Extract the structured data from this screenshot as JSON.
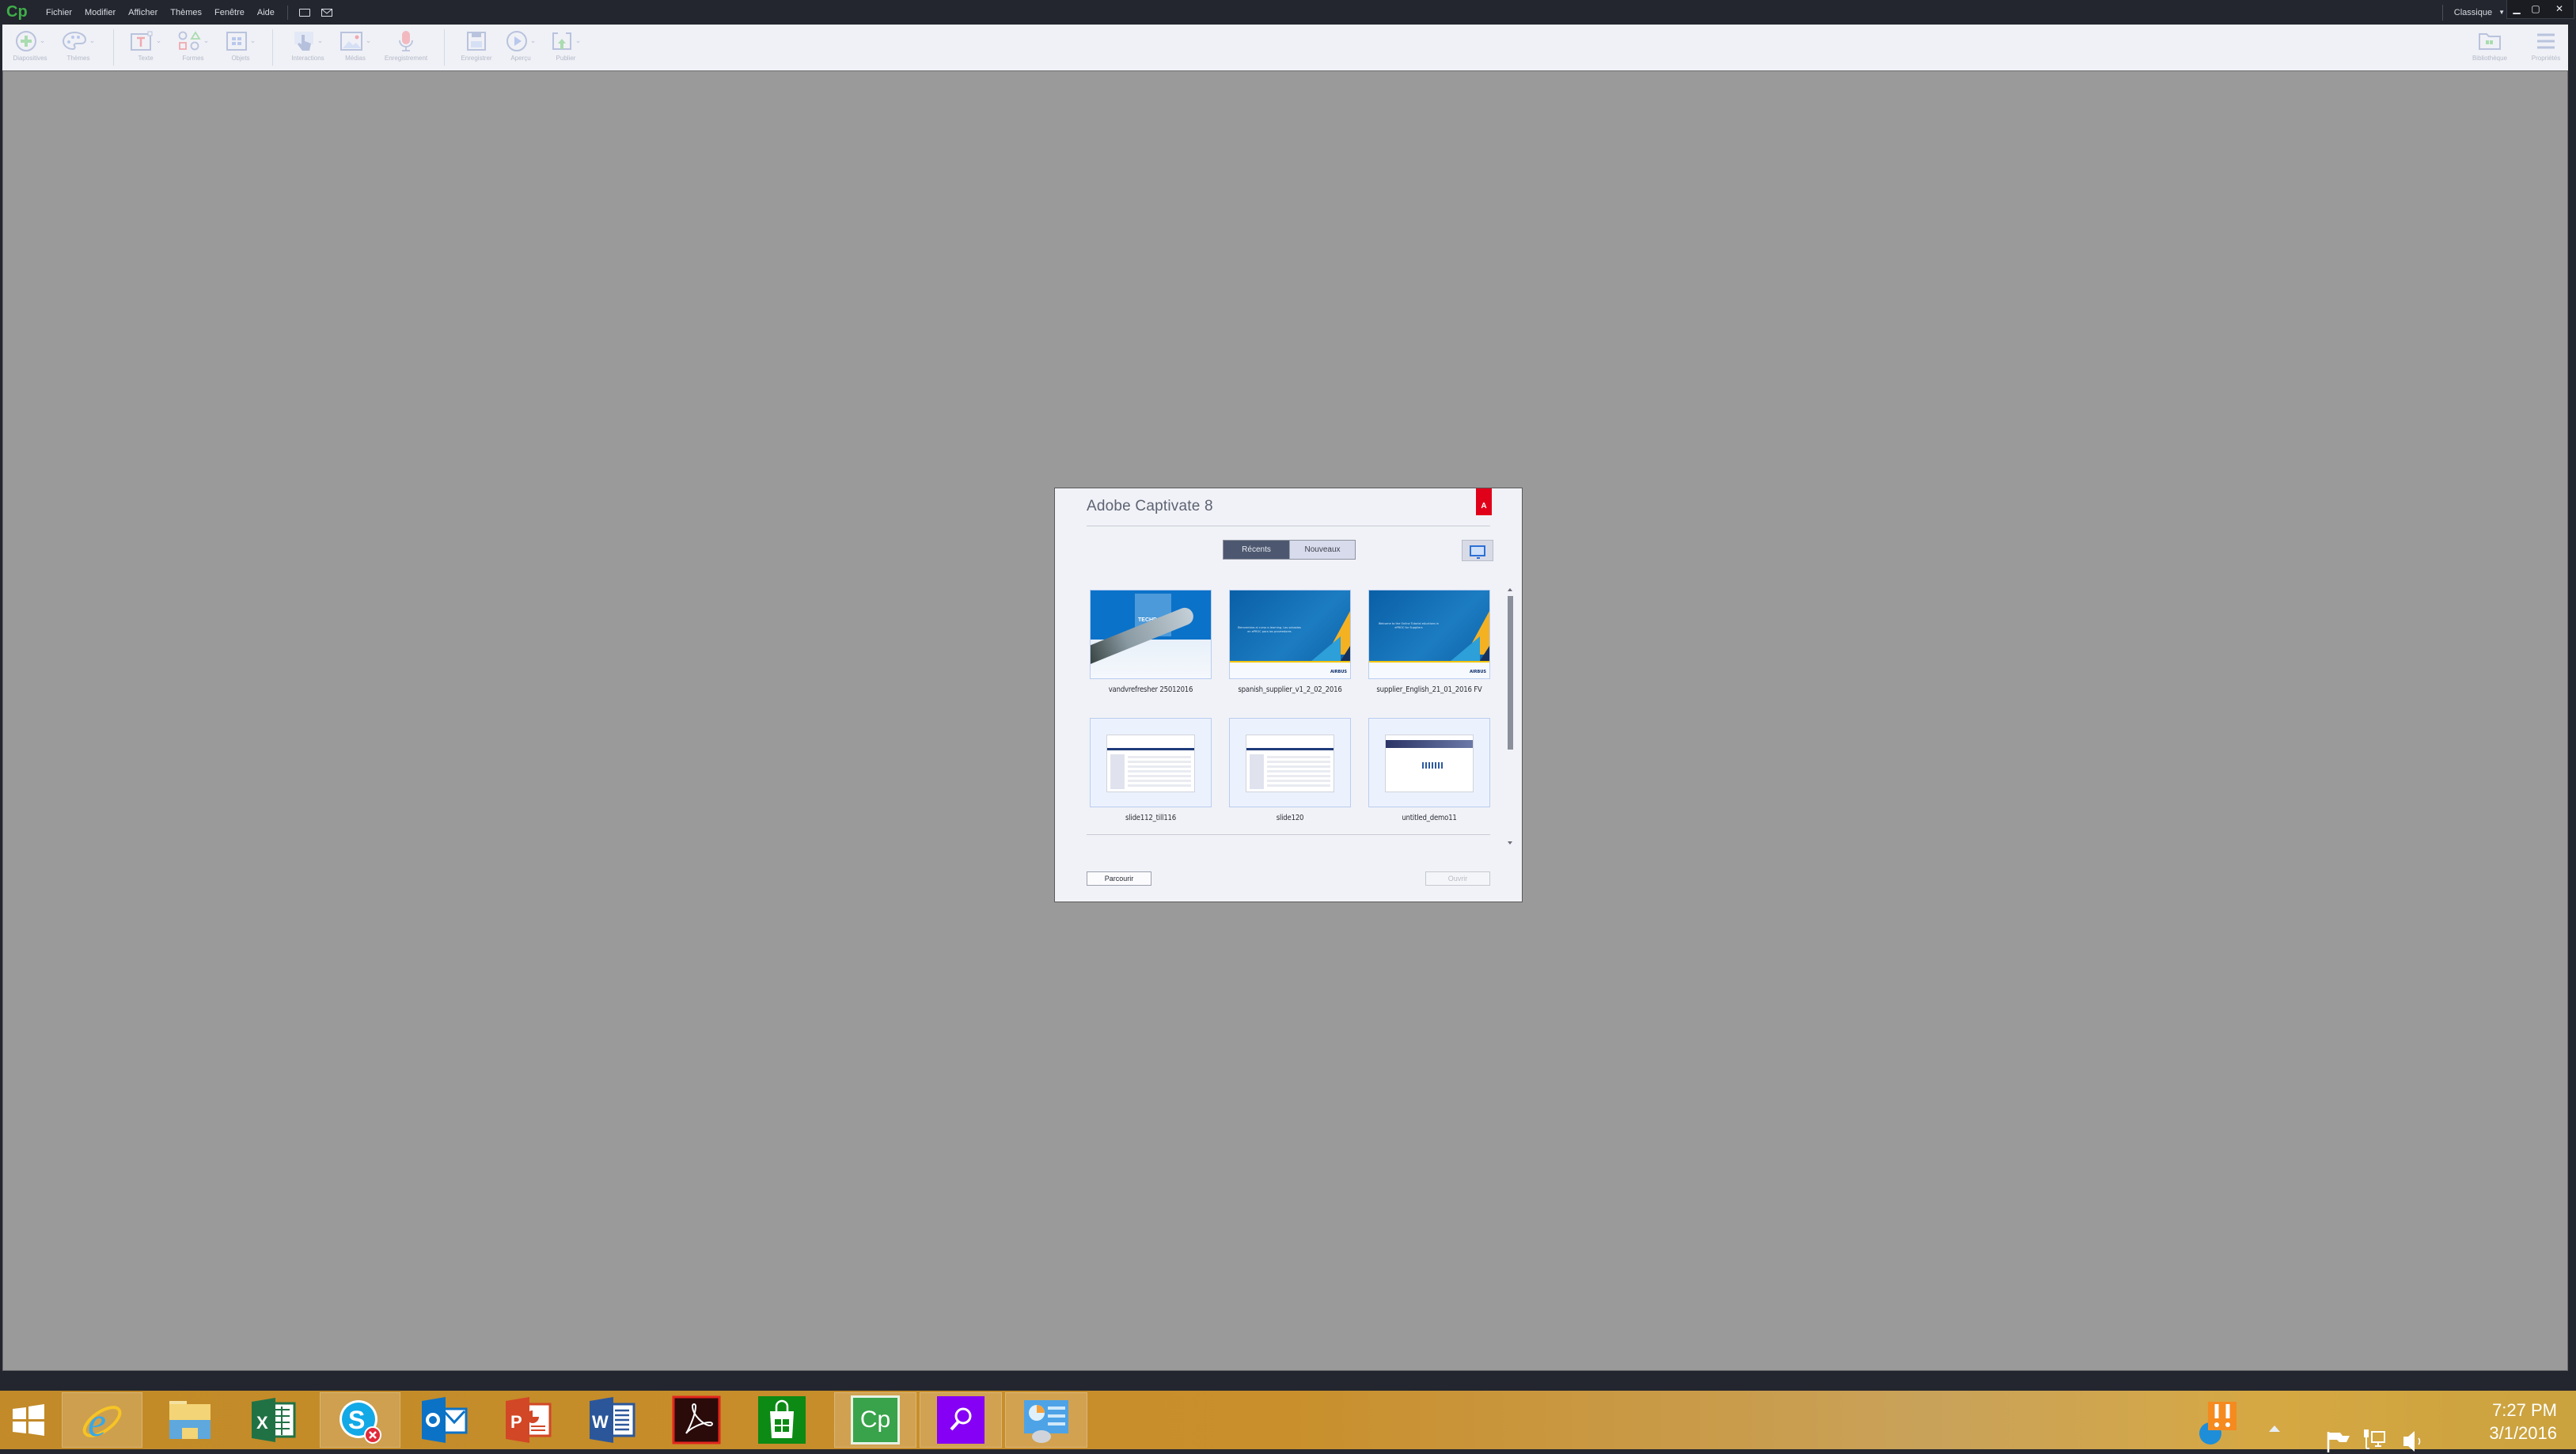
{
  "app": {
    "logo": "Cp",
    "menu": [
      "Fichier",
      "Modifier",
      "Afficher",
      "Thèmes",
      "Fenêtre",
      "Aide"
    ],
    "workspace": "Classique",
    "window_controls": {
      "minimize": "▁",
      "maximize": "▢",
      "close": "✕"
    }
  },
  "toolbar": {
    "groups": [
      [
        {
          "label": "Diapositives",
          "icon": "plus-circle-icon",
          "dropdown": true
        },
        {
          "label": "Thèmes",
          "icon": "palette-icon",
          "dropdown": true
        }
      ],
      [
        {
          "label": "Texte",
          "icon": "text-box-icon",
          "dropdown": true
        },
        {
          "label": "Formes",
          "icon": "shapes-icon",
          "dropdown": true
        },
        {
          "label": "Objets",
          "icon": "objects-grid-icon",
          "dropdown": true
        }
      ],
      [
        {
          "label": "Interactions",
          "icon": "hand-pointer-icon",
          "dropdown": true
        },
        {
          "label": "Médias",
          "icon": "image-icon",
          "dropdown": true
        },
        {
          "label": "Enregistrement",
          "icon": "microphone-icon",
          "dropdown": false
        }
      ],
      [
        {
          "label": "Enregistrer",
          "icon": "floppy-disk-icon",
          "dropdown": false
        },
        {
          "label": "Aperçu",
          "icon": "play-circle-icon",
          "dropdown": true
        },
        {
          "label": "Publier",
          "icon": "publish-icon",
          "dropdown": true
        }
      ]
    ],
    "right": [
      {
        "label": "Bibliothèque",
        "icon": "library-folder-icon"
      },
      {
        "label": "Propriétés",
        "icon": "properties-lines-icon"
      }
    ]
  },
  "dialog": {
    "title": "Adobe Captivate 8",
    "adobe_logo": "A",
    "tabs": [
      {
        "label": "Récents",
        "active": true
      },
      {
        "label": "Nouveaux",
        "active": false
      }
    ],
    "view_toggle_icon": "monitor-view-icon",
    "projects": [
      {
        "name": "vandvrefresher 25012016",
        "thumb": "techdata",
        "thumb_text": "TECHDATA"
      },
      {
        "name": "spanish_supplier_v1_2_02_2016",
        "thumb": "blue",
        "thumb_text": "Bienvenidos al curso e-learning. Las subastas en ePROC para los proveedores",
        "brand": "AIRBUS"
      },
      {
        "name": "supplier_English_21_01_2016 FV",
        "thumb": "blue",
        "thumb_text": "Welcome to the Online Tutorial eAuctions in ePROC for Suppliers",
        "brand": "AIRBUS"
      },
      {
        "name": "slide112_till116",
        "thumb": "screenshot"
      },
      {
        "name": "slide120",
        "thumb": "screenshot"
      },
      {
        "name": "untitled_demo11",
        "thumb": "screenshot2"
      }
    ],
    "browse_label": "Parcourir",
    "open_label": "Ouvrir",
    "open_enabled": false
  },
  "taskbar": {
    "apps": [
      {
        "name": "start",
        "icon": "windows-start-icon"
      },
      {
        "name": "Internet Explorer",
        "icon": "internet-explorer-icon",
        "active": true
      },
      {
        "name": "File Explorer",
        "icon": "file-explorer-icon"
      },
      {
        "name": "Excel",
        "icon": "excel-icon"
      },
      {
        "name": "Skype",
        "icon": "skype-icon",
        "active": true,
        "badge": "error"
      },
      {
        "name": "Outlook",
        "icon": "outlook-icon"
      },
      {
        "name": "PowerPoint",
        "icon": "powerpoint-icon"
      },
      {
        "name": "Word",
        "icon": "word-icon"
      },
      {
        "name": "Acrobat",
        "icon": "acrobat-icon"
      },
      {
        "name": "Store",
        "icon": "store-icon"
      },
      {
        "name": "Captivate",
        "icon": "captivate-icon",
        "active": true,
        "label": "Cp"
      },
      {
        "name": "Search",
        "icon": "search-app-icon",
        "active": true
      },
      {
        "name": "Control Panel",
        "icon": "control-panel-icon",
        "active": true
      }
    ],
    "tray": {
      "time": "7:27 PM",
      "date": "3/1/2016",
      "icons": [
        "alert-notification-icon",
        "show-hidden-icons-icon",
        "action-center-flag-icon",
        "network-icon",
        "volume-icon"
      ]
    }
  }
}
